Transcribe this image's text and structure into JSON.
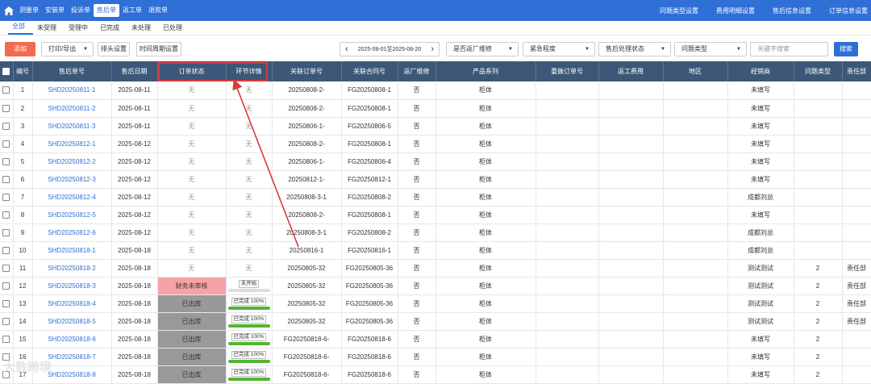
{
  "nav": {
    "items": [
      "测量单",
      "安装单",
      "投诉单",
      "售后单",
      "返工单",
      "退款单"
    ],
    "active": 3,
    "right": [
      "问题类型设置",
      "费用明细设置",
      "售后信息设置",
      "订单信息设置"
    ]
  },
  "tabs": {
    "items": [
      "全部",
      "未受理",
      "受理中",
      "已完成",
      "未处理",
      "已处理"
    ],
    "active": 0
  },
  "toolbar": {
    "add": "添加",
    "print": "打印/导出",
    "header_settings": "排头设置",
    "time_settings": "时间周期设置",
    "date_range": "2025-08-01至2025-08-20",
    "prev": "‹",
    "next": "›",
    "filters": [
      "是否返厂维修",
      "紧急程度",
      "售后处理状态",
      "问题类型"
    ],
    "keyword_placeholder": "关键字搜索",
    "search": "搜索"
  },
  "table": {
    "headers": [
      "编号",
      "售后单号",
      "售后日期",
      "订单状态",
      "环节详情",
      "关联订单号",
      "关联合同号",
      "返厂维修",
      "产品系列",
      "重做订单号",
      "返工费用",
      "地区",
      "经销商",
      "问题类型",
      "责任部"
    ],
    "rows": [
      {
        "no": "1",
        "sn": "SHD20250811-1",
        "date": "2025-08-11",
        "status": "无",
        "detail": "无",
        "order": "20250808-2-",
        "contract": "FG20250808-1",
        "repair": "否",
        "series": "柜体",
        "dealer": "未填写",
        "qtype": "",
        "dept": ""
      },
      {
        "no": "2",
        "sn": "SHD20250811-2",
        "date": "2025-08-11",
        "status": "无",
        "detail": "无",
        "order": "20250808-2-",
        "contract": "FG20250808-1",
        "repair": "否",
        "series": "柜体",
        "dealer": "未填写",
        "qtype": "",
        "dept": ""
      },
      {
        "no": "3",
        "sn": "SHD20250811-3",
        "date": "2025-08-11",
        "status": "无",
        "detail": "无",
        "order": "20250806-1-",
        "contract": "FG20250806-5",
        "repair": "否",
        "series": "柜体",
        "dealer": "未填写",
        "qtype": "",
        "dept": ""
      },
      {
        "no": "4",
        "sn": "SHD20250812-1",
        "date": "2025-08-12",
        "status": "无",
        "detail": "无",
        "order": "20250808-2-",
        "contract": "FG20250808-1",
        "repair": "否",
        "series": "柜体",
        "dealer": "未填写",
        "qtype": "",
        "dept": ""
      },
      {
        "no": "5",
        "sn": "SHD20250812-2",
        "date": "2025-08-12",
        "status": "无",
        "detail": "无",
        "order": "20250806-1-",
        "contract": "FG20250806-4",
        "repair": "否",
        "series": "柜体",
        "dealer": "未填写",
        "qtype": "",
        "dept": ""
      },
      {
        "no": "6",
        "sn": "SHD20250812-3",
        "date": "2025-08-12",
        "status": "无",
        "detail": "无",
        "order": "20250812-1-",
        "contract": "FG20250812-1",
        "repair": "否",
        "series": "柜体",
        "dealer": "未填写",
        "qtype": "",
        "dept": ""
      },
      {
        "no": "7",
        "sn": "SHD20250812-4",
        "date": "2025-08-12",
        "status": "无",
        "detail": "无",
        "order": "20250808-3-1",
        "contract": "FG20250808-2",
        "repair": "否",
        "series": "柜体",
        "dealer": "成都刘总",
        "qtype": "",
        "dept": ""
      },
      {
        "no": "8",
        "sn": "SHD20250812-5",
        "date": "2025-08-12",
        "status": "无",
        "detail": "无",
        "order": "20250808-2-",
        "contract": "FG20250808-1",
        "repair": "否",
        "series": "柜体",
        "dealer": "未填写",
        "qtype": "",
        "dept": ""
      },
      {
        "no": "9",
        "sn": "SHD20250812-6",
        "date": "2025-08-12",
        "status": "无",
        "detail": "无",
        "order": "20250808-3-1",
        "contract": "FG20250808-2",
        "repair": "否",
        "series": "柜体",
        "dealer": "成都刘总",
        "qtype": "",
        "dept": ""
      },
      {
        "no": "10",
        "sn": "SHD20250818-1",
        "date": "2025-08-18",
        "status": "无",
        "detail": "无",
        "order": "20250816-1",
        "contract": "FG20250816-1",
        "repair": "否",
        "series": "柜体",
        "dealer": "成都刘总",
        "qtype": "",
        "dept": ""
      },
      {
        "no": "11",
        "sn": "SHD20250818-2",
        "date": "2025-08-18",
        "status": "无",
        "detail": "无",
        "order": "20250805-32",
        "contract": "FG20250805-36",
        "repair": "否",
        "series": "柜体",
        "dealer": "测试测试",
        "qtype": "2",
        "dept": "责任部"
      },
      {
        "no": "12",
        "sn": "SHD20250818-3",
        "date": "2025-08-18",
        "status": "财务未审核",
        "detail": "未开始",
        "progress": 0,
        "order": "20250805-32",
        "contract": "FG20250805-36",
        "repair": "否",
        "series": "柜体",
        "dealer": "测试测试",
        "qtype": "2",
        "dept": "责任部"
      },
      {
        "no": "13",
        "sn": "SHD20250818-4",
        "date": "2025-08-18",
        "status": "已出库",
        "detail": "已完成 100%",
        "progress": 100,
        "order": "20250805-32",
        "contract": "FG20250805-36",
        "repair": "否",
        "series": "柜体",
        "dealer": "测试测试",
        "qtype": "2",
        "dept": "责任部"
      },
      {
        "no": "14",
        "sn": "SHD20250818-5",
        "date": "2025-08-18",
        "status": "已出库",
        "detail": "已完成 100%",
        "progress": 100,
        "order": "20250805-32",
        "contract": "FG20250805-36",
        "repair": "否",
        "series": "柜体",
        "dealer": "测试测试",
        "qtype": "2",
        "dept": "责任部"
      },
      {
        "no": "15",
        "sn": "SHD20250818-6",
        "date": "2025-08-18",
        "status": "已出库",
        "detail": "已完成 100%",
        "progress": 100,
        "order": "FG20250818-6-",
        "contract": "FG20250818-6",
        "repair": "否",
        "series": "柜体",
        "dealer": "未填写",
        "qtype": "2",
        "dept": ""
      },
      {
        "no": "16",
        "sn": "SHD20250818-7",
        "date": "2025-08-18",
        "status": "已出库",
        "detail": "已完成 100%",
        "progress": 100,
        "order": "FG20250818-6-",
        "contract": "FG20250818-6",
        "repair": "否",
        "series": "柜体",
        "dealer": "未填写",
        "qtype": "2",
        "dept": ""
      },
      {
        "no": "17",
        "sn": "SHD20250818-8",
        "date": "2025-08-18",
        "status": "已出库",
        "detail": "已完成 100%",
        "progress": 100,
        "order": "FG20250818-6-",
        "contract": "FG20250818-6",
        "repair": "否",
        "series": "柜体",
        "dealer": "未填写",
        "qtype": "2",
        "dept": ""
      }
    ]
  },
  "watermark": "大数跨境",
  "colors": {
    "nav": "#2f6fd6",
    "table_header": "#3c5778",
    "add": "#f26a4f",
    "highlight": "#d93a3a",
    "finance_pending": "#f5a3a3",
    "shipped": "#999999",
    "progress": "#52b532"
  }
}
